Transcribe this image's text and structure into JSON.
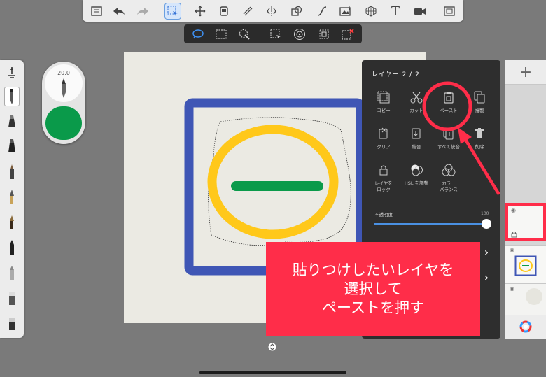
{
  "top_toolbar": {
    "tools": [
      "gallery-icon",
      "undo-icon",
      "redo-icon",
      "selection-icon",
      "transform-icon",
      "layer-import-icon",
      "ruler-icon",
      "symmetry-icon",
      "shape-icon",
      "curve-icon",
      "image-import-icon",
      "perspective-grid-icon",
      "text-tool-icon",
      "video-icon",
      "fullscreen-icon"
    ]
  },
  "selection_toolbar": {
    "tools": [
      "lasso-select-icon",
      "rect-select-icon",
      "magic-wand-icon",
      "crop-select-icon",
      "target-icon",
      "deselect-icon",
      "clear-select-icon"
    ]
  },
  "brush_puck": {
    "size": "20.0",
    "color": "#0a9a4a"
  },
  "layer_menu": {
    "title": "レイヤー 2 / 2",
    "items": [
      {
        "label": "コピー",
        "icon": "copy-icon"
      },
      {
        "label": "カット",
        "icon": "scissors-icon"
      },
      {
        "label": "ペースト",
        "icon": "paste-icon"
      },
      {
        "label": "複製",
        "icon": "duplicate-icon"
      },
      {
        "label": "クリア",
        "icon": "clear-icon"
      },
      {
        "label": "結合",
        "icon": "merge-icon"
      },
      {
        "label": "すべて統合",
        "icon": "merge-all-icon"
      },
      {
        "label": "削除",
        "icon": "trash-icon"
      },
      {
        "label": "レイヤを\nロック",
        "icon": "lock-icon"
      },
      {
        "label": "HSL を調整",
        "icon": "hsl-icon"
      },
      {
        "label": "カラー\nバランス",
        "icon": "color-balance-icon"
      }
    ],
    "opacity_label": "不透明度",
    "opacity_value": "100",
    "opacity": 1.0
  },
  "callout": {
    "line1": "貼りつけしたいレイヤを",
    "line2": "選択して",
    "line3": "ペーストを押す"
  },
  "colors": {
    "accent": "#ff2d49",
    "selection_blue": "#4a90e2",
    "frame_blue": "#3f56b5",
    "ring_yellow": "#ffc81a",
    "bar_green": "#0a9a4a"
  }
}
